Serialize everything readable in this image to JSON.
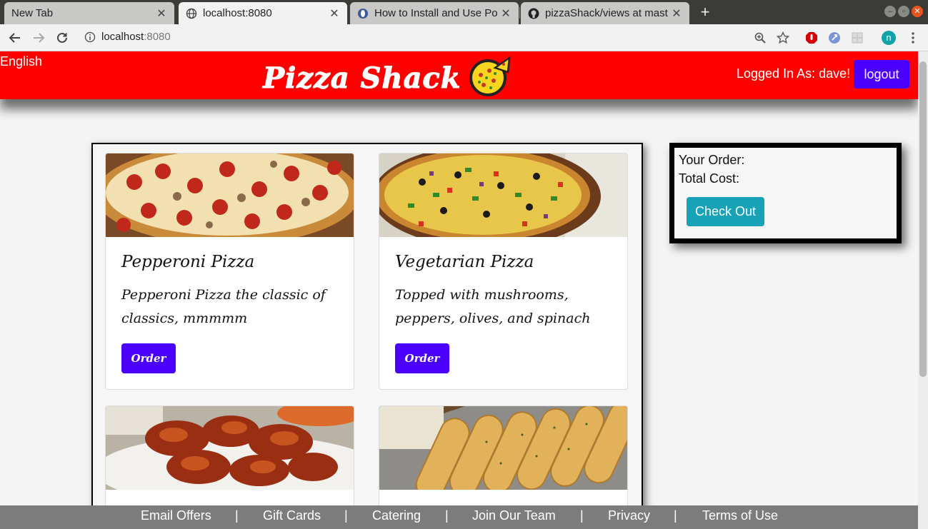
{
  "browser": {
    "tabs": [
      {
        "title": "New Tab",
        "active": false
      },
      {
        "title": "localhost:8080",
        "active": true
      },
      {
        "title": "How to Install and Use Po",
        "active": false
      },
      {
        "title": "pizzaShack/views at mast",
        "active": false
      }
    ],
    "new_tab_label": "+",
    "url_host": "localhost",
    "url_port": ":8080",
    "profile_initial": "n"
  },
  "header": {
    "language": "English",
    "brand": "Pizza Shack",
    "logged_in_text": "Logged In As: dave!",
    "logout_label": "logout",
    "colors": {
      "header_bg": "#ff0000",
      "button_bg": "#4b00ff"
    }
  },
  "menu": {
    "items": [
      {
        "title": "Pepperoni Pizza",
        "description": "Pepperoni Pizza the classic of classics, mmmmm",
        "button": "Order",
        "image": "pepperoni-pizza-photo"
      },
      {
        "title": "Vegetarian Pizza",
        "description": "Topped with mushrooms, peppers, olives, and spinach",
        "button": "Order",
        "image": "vegetarian-pizza-photo"
      },
      {
        "image": "chicken-wings-photo"
      },
      {
        "image": "breadsticks-photo"
      }
    ]
  },
  "order": {
    "your_order_label": "Your Order:",
    "total_cost_label": "Total Cost:",
    "checkout_label": "Check Out",
    "checkout_color": "#17a2b8"
  },
  "footer": {
    "links": [
      "Email Offers",
      "Gift Cards",
      "Catering",
      "Join Our Team",
      "Privacy",
      "Terms of Use"
    ],
    "separator": "|"
  }
}
